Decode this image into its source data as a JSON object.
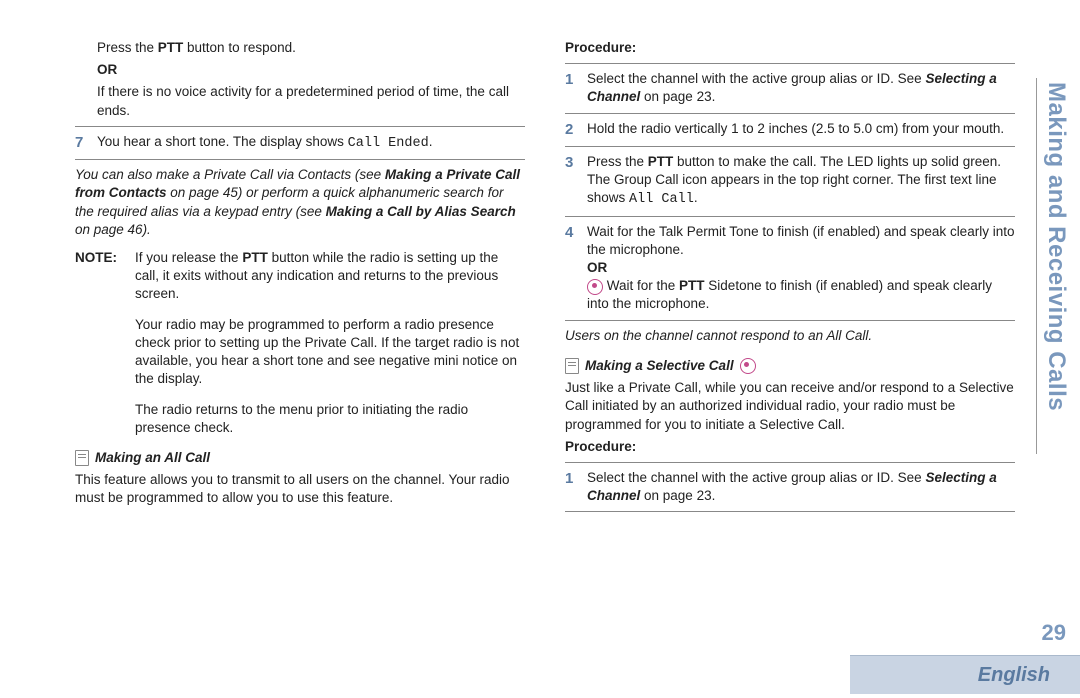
{
  "side_tab": "Making and Receiving Calls",
  "page_number": "29",
  "language": "English",
  "left": {
    "intro_press": "Press the ",
    "ptt": "PTT",
    "intro_press_end": " button to respond.",
    "or": "OR",
    "no_voice": "If there is no voice activity for a predetermined period of time, the call ends.",
    "step7_num": "7",
    "step7_a": "You hear a short tone. The display shows ",
    "step7_mono": "Call Ended",
    "italic_a": "You can also make a Private Call via Contacts (see ",
    "italic_b": "Making a Private Call from Contacts",
    "italic_c": " on page 45) or perform a quick alphanumeric search for the required alias via a keypad entry (see ",
    "italic_d": "Making a Call by Alias Search",
    "italic_e": " on page 46).",
    "note_label": "NOTE:",
    "note1_a": "If you release the ",
    "note1_b": " button while the radio is setting up the call, it exits without any indication and returns to the previous screen.",
    "note2": "Your radio may be programmed to perform a radio presence check prior to setting up the Private Call. If the target radio is not available, you hear a short tone and see negative mini notice on the display.",
    "note3": "The radio returns to the menu prior to initiating the radio presence check.",
    "sec_allcall": "Making an All Call",
    "allcall_desc": "This feature allows you to transmit to all users on the channel. Your radio must be programmed to allow you to use this feature."
  },
  "right": {
    "procedure": "Procedure:",
    "s1_num": "1",
    "s1_a": "Select the channel with the active group alias or ID. See ",
    "s1_b": "Selecting a Channel",
    "s1_c": " on page 23.",
    "s2_num": "2",
    "s2": "Hold the radio vertically 1 to 2 inches (2.5 to 5.0 cm) from your mouth.",
    "s3_num": "3",
    "s3_a": "Press the ",
    "s3_b": " button to make the call. The LED lights up solid green. The Group Call icon appears in the top right corner. The first text line shows ",
    "s3_mono": "All Call",
    "s4_num": "4",
    "s4": "Wait for the Talk Permit Tone to finish (if enabled) and speak clearly into the microphone.",
    "or": "OR",
    "s4_or_a": "Wait for the ",
    "s4_or_b": " Sidetone to finish (if enabled) and speak clearly into the microphone.",
    "italic_after": "Users on the channel cannot respond to an All Call.",
    "sec_selective": "Making a Selective Call",
    "selective_desc": "Just like a Private Call, while you can receive and/or respond to a Selective Call initiated by an authorized individual radio, your radio must be programmed for you to initiate a Selective Call.",
    "procedure2": "Procedure:",
    "p2_s1_num": "1",
    "p2_s1_a": "Select the channel with the active group alias or ID. See ",
    "p2_s1_b": "Selecting a Channel",
    "p2_s1_c": " on page 23."
  }
}
